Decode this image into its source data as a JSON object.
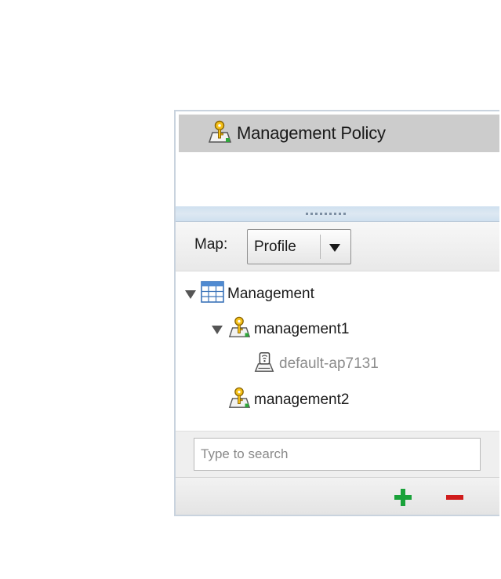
{
  "policy_list": {
    "items": [
      {
        "label": "Management Policy",
        "icon": "key-policy-icon",
        "selected": true
      }
    ]
  },
  "map": {
    "label": "Map:",
    "selected": "Profile"
  },
  "tree": {
    "root": {
      "label": "Management",
      "icon": "table-grid-icon",
      "expanded": true
    },
    "children": [
      {
        "label": "management1",
        "icon": "key-policy-icon",
        "expanded": true,
        "children": [
          {
            "label": "default-ap7131",
            "icon": "access-point-device-icon"
          }
        ]
      },
      {
        "label": "management2",
        "icon": "key-policy-icon"
      }
    ]
  },
  "search": {
    "placeholder": "Type to search",
    "value": ""
  },
  "actions": {
    "add": {
      "icon": "plus-icon",
      "color": "#1aa23a"
    },
    "remove": {
      "icon": "minus-icon",
      "color": "#d01c1c"
    }
  },
  "colors": {
    "selected_row": "#cccccc",
    "splitter": "#cfe0ef",
    "dim_text": "#8c8c8c"
  }
}
